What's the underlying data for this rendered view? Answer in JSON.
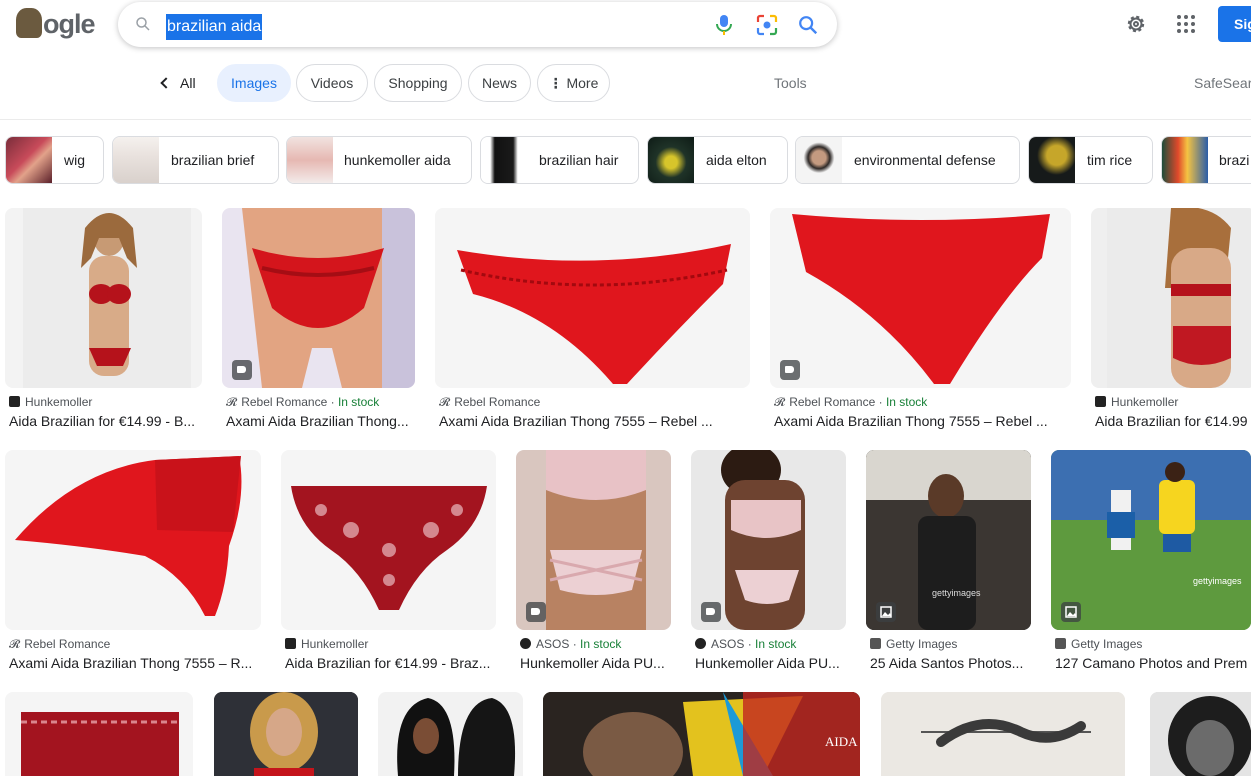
{
  "header": {
    "logo_text": "Google",
    "query": "brazilian aida",
    "signin_label": "Sig"
  },
  "tabs": {
    "all": "All",
    "images": "Images",
    "videos": "Videos",
    "shopping": "Shopping",
    "news": "News",
    "more": "More",
    "tools": "Tools",
    "safesearch": "SafeSear"
  },
  "related": [
    {
      "label": "wig"
    },
    {
      "label": "brazilian brief"
    },
    {
      "label": "hunkemoller aida"
    },
    {
      "label": "brazilian hair"
    },
    {
      "label": "aida elton"
    },
    {
      "label": "environmental defense"
    },
    {
      "label": "tim rice"
    },
    {
      "label": "brazi"
    }
  ],
  "results": [
    {
      "source": "Hunkemoller",
      "stock": "",
      "title": "Aida Brazilian for €14.99 - B..."
    },
    {
      "source": "Rebel Romance",
      "stock": "In stock",
      "title": "Axami Aida Brazilian Thong..."
    },
    {
      "source": "Rebel Romance",
      "stock": "",
      "title": "Axami Aida Brazilian Thong 7555 – Rebel ..."
    },
    {
      "source": "Rebel Romance",
      "stock": "In stock",
      "title": "Axami Aida Brazilian Thong 7555 – Rebel ..."
    },
    {
      "source": "Hunkemoller",
      "stock": "",
      "title": "Aida Brazilian for €14.99"
    },
    {
      "source": "Rebel Romance",
      "stock": "",
      "title": "Axami Aida Brazilian Thong 7555 – R..."
    },
    {
      "source": "Hunkemoller",
      "stock": "",
      "title": "Aida Brazilian for €14.99 - Braz..."
    },
    {
      "source": "ASOS",
      "stock": "In stock",
      "title": "Hunkemoller Aida PU..."
    },
    {
      "source": "ASOS",
      "stock": "In stock",
      "title": "Hunkemoller Aida PU..."
    },
    {
      "source": "Getty Images",
      "stock": "",
      "title": "25 Aida Santos Photos..."
    },
    {
      "source": "Getty Images",
      "stock": "",
      "title": "127 Camano Photos and Prem"
    }
  ],
  "image_watermarks": {
    "getty1": "gettyimages",
    "getty2": "gettyimages",
    "aida_poster": "AIDA"
  }
}
